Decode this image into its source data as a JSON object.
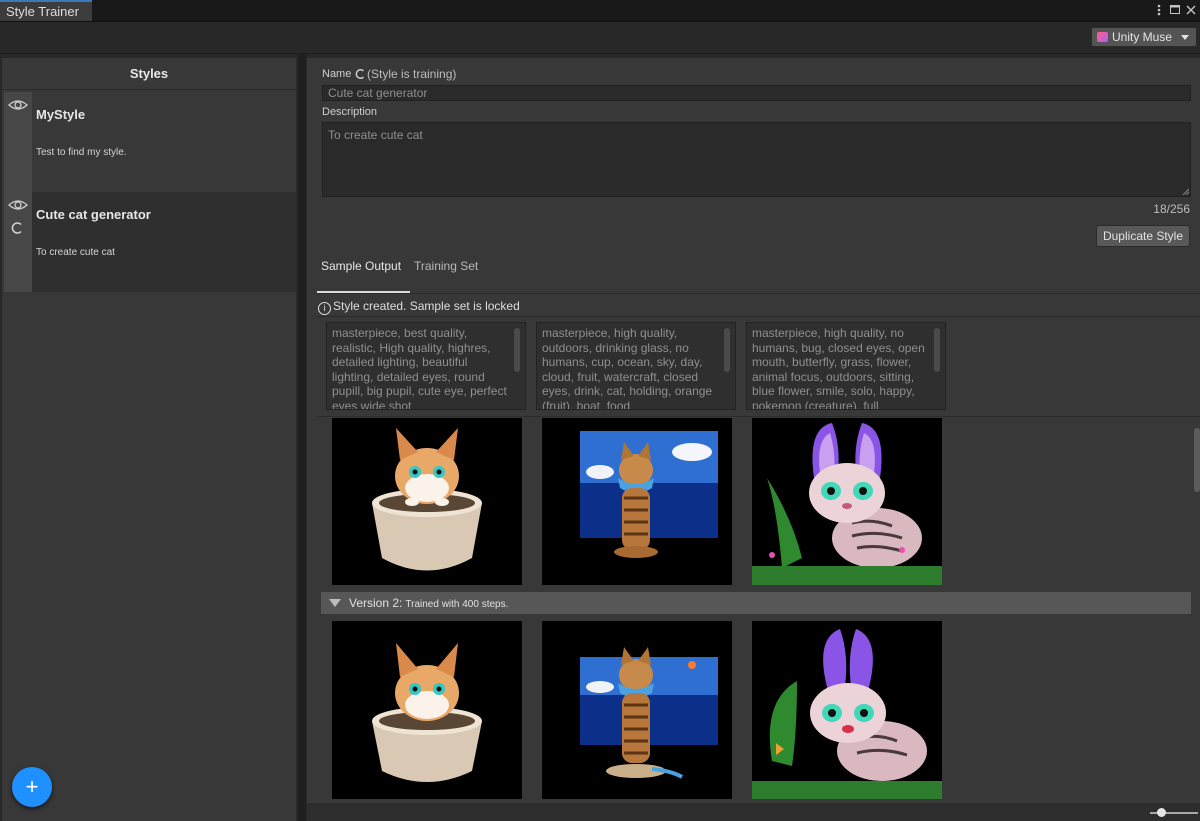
{
  "window": {
    "tab_title": "Style Trainer",
    "more_icon": "kebab-icon",
    "maximize_icon": "maximize-icon",
    "close_icon": "close-icon"
  },
  "toolbar": {
    "account_label": "Unity Muse",
    "account_icon": "muse-logo-icon"
  },
  "sidebar": {
    "title": "Styles",
    "items": [
      {
        "title": "MyStyle",
        "description": "Test to find my style.",
        "training": false,
        "selected": false
      },
      {
        "title": "Cute cat generator",
        "description": "To create cute cat",
        "training": true,
        "selected": true
      }
    ],
    "add_button": "+"
  },
  "detail": {
    "name_label": "Name",
    "training_status": "(Style is training)",
    "name_value": "Cute cat generator",
    "description_label": "Description",
    "description_value": "To create cute cat",
    "char_count": "18/256",
    "duplicate_button": "Duplicate Style"
  },
  "tabs": [
    {
      "label": "Sample Output",
      "active": true
    },
    {
      "label": "Training Set",
      "active": false
    }
  ],
  "notice": "Style created. Sample set is locked",
  "prompts": [
    "masterpiece, best quality, realistic, High quality, highres, detailed lighting, beautiful lighting, detailed eyes, round pupill, big pupil, cute eye, perfect eyes wide shot",
    "masterpiece, high quality, outdoors, drinking glass, no humans, cup, ocean, sky, day, cloud, fruit, watercraft, closed eyes, drink, cat, holding, orange (fruit), boat, food",
    "masterpiece, high quality, no humans, bug, closed eyes, open mouth, butterfly, grass, flower, animal focus, outdoors, sitting, blue flower, smile, solo, happy, pokemon (creature), full"
  ],
  "sample_images": [
    {
      "subject": "kitten-in-bucket"
    },
    {
      "subject": "cat-with-scarf-by-sea"
    },
    {
      "subject": "bunny-eared-cat"
    }
  ],
  "version": {
    "label": "Version 2:",
    "detail": "Trained with 400 steps.",
    "images": [
      {
        "subject": "kitten-in-bucket"
      },
      {
        "subject": "cat-with-scarf-by-sea"
      },
      {
        "subject": "bunny-eared-cat"
      }
    ]
  },
  "colors": {
    "accent_blue": "#1e90ff",
    "panel": "#383838",
    "background": "#282828"
  }
}
